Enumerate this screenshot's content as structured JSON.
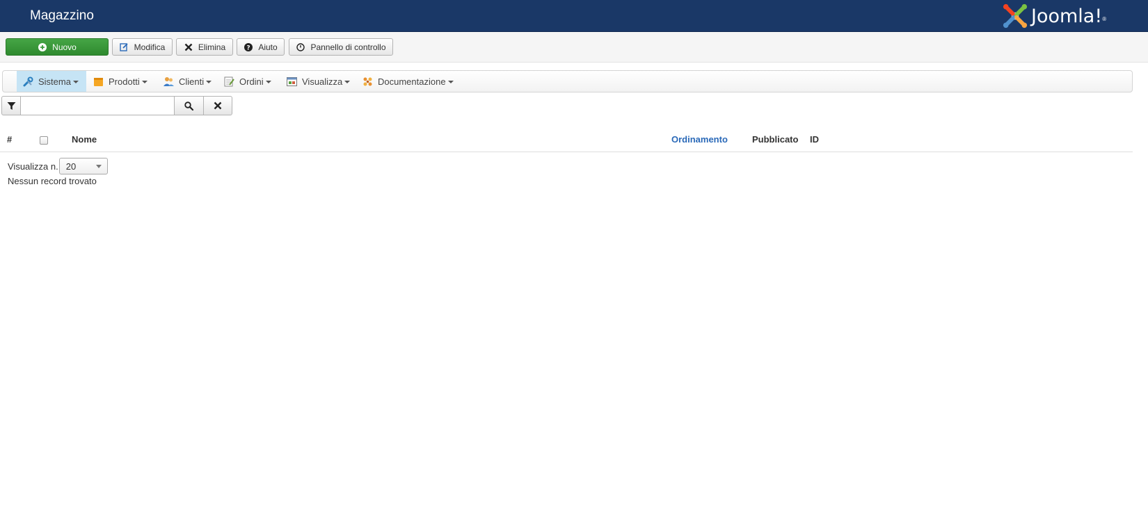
{
  "header": {
    "title": "Magazzino",
    "logo_text": "Joomla!"
  },
  "toolbar": {
    "new_label": "Nuovo",
    "edit_label": "Modifica",
    "delete_label": "Elimina",
    "help_label": "Aiuto",
    "control_panel_label": "Pannello di controllo"
  },
  "menu": {
    "items": [
      {
        "label": "Sistema",
        "icon": "tools-icon",
        "active": true
      },
      {
        "label": "Prodotti",
        "icon": "box-icon"
      },
      {
        "label": "Clienti",
        "icon": "users-icon"
      },
      {
        "label": "Ordini",
        "icon": "orders-icon"
      },
      {
        "label": "Visualizza",
        "icon": "view-icon"
      },
      {
        "label": "Documentazione",
        "icon": "docs-icon"
      }
    ]
  },
  "search": {
    "value": ""
  },
  "table": {
    "columns": {
      "num": "#",
      "name": "Nome",
      "ordering": "Ordinamento",
      "published": "Pubblicato",
      "id": "ID"
    }
  },
  "list": {
    "limit_label": "Visualizza n.",
    "limit_value": "20",
    "empty_message": "Nessun record trovato"
  },
  "colors": {
    "header_bg": "#1a3867",
    "new_button": "#3d9a3d",
    "link": "#2a69b8",
    "active_menu": "#c6e4f5"
  }
}
